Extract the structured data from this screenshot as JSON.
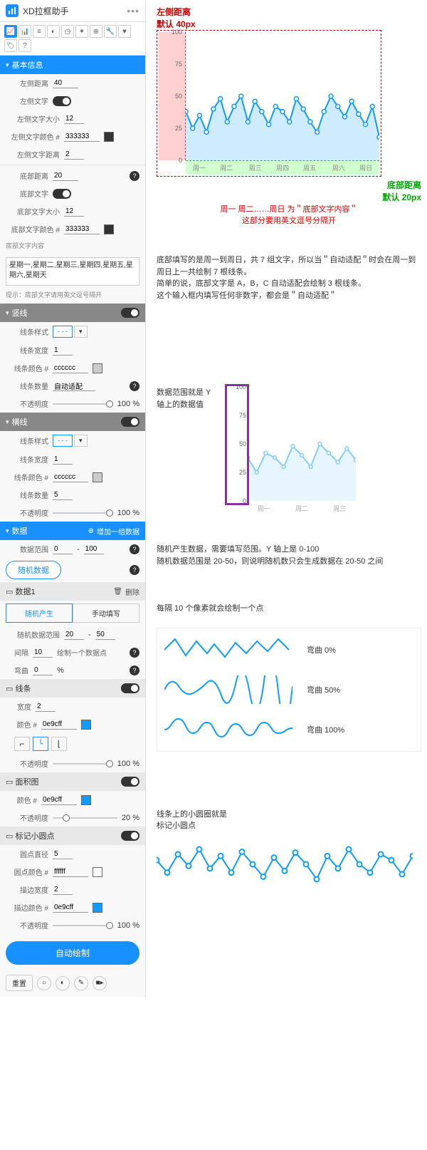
{
  "header": {
    "title": "XD拉框助手",
    "more": "•••"
  },
  "sections": {
    "basic": {
      "title": "基本信息",
      "left_distance_label": "左侧距离",
      "left_distance": "40",
      "left_text_label": "左侧文字",
      "left_text_size_label": "左侧文字大小",
      "left_text_size": "12",
      "left_text_color_label": "左侧文字颜色 #",
      "left_text_color": "333333",
      "left_text_gap_label": "左侧文字距离",
      "left_text_gap": "2",
      "bottom_distance_label": "底部距离",
      "bottom_distance": "20",
      "bottom_text_label": "底部文字",
      "bottom_text_size_label": "底部文字大小",
      "bottom_text_size": "12",
      "bottom_text_color_label": "底部文字颜色 #",
      "bottom_text_color": "333333",
      "bottom_text_content_label": "底部文字内容",
      "bottom_text_content": "星期一,星期二,星期三,星期四,星期五,星期六,星期天",
      "bottom_hint": "提示：底部文字请用英文逗号隔开"
    },
    "vline": {
      "title": "竖线",
      "style_label": "线条样式",
      "width_label": "线条宽度",
      "width": "1",
      "color_label": "线条颜色 #",
      "color": "cccccc",
      "count_label": "线条数量",
      "count": "自动适配",
      "opacity_label": "不透明度",
      "opacity": "100 %"
    },
    "hline": {
      "title": "横线",
      "style_label": "线条样式",
      "width_label": "线条宽度",
      "width": "1",
      "color_label": "线条颜色 #",
      "color": "cccccc",
      "count_label": "线条数量",
      "count": "5",
      "opacity_label": "不透明度",
      "opacity": "100 %"
    },
    "data": {
      "title": "数据",
      "add_label": "增加一组数据",
      "range_label": "数据范围",
      "range_min": "0",
      "range_sep": "-",
      "range_max": "100",
      "random_btn": "随机数据"
    },
    "data1": {
      "title": "数据1",
      "delete_label": "删除",
      "tab_random": "随机产生",
      "tab_manual": "手动填写",
      "random_range_label": "随机数据范围",
      "random_min": "20",
      "random_sep": "-",
      "random_max": "50",
      "interval_label": "间隔",
      "interval": "10",
      "interval_suffix": "绘制一个数据点",
      "bend_label": "弯曲",
      "bend": "0",
      "bend_unit": "%"
    },
    "line": {
      "title": "线条",
      "width_label": "宽度",
      "width": "2",
      "color_label": "颜色 #",
      "color": "0e9cff",
      "opacity_label": "不透明度",
      "opacity": "100 %"
    },
    "area": {
      "title": "面积图",
      "color_label": "颜色 #",
      "color": "0e9cff",
      "opacity_label": "不透明度",
      "opacity": "20 %"
    },
    "marker": {
      "title": "标记小圆点",
      "diameter_label": "圆点直径",
      "diameter": "5",
      "fill_label": "圆点颜色 #",
      "fill": "ffffff",
      "stroke_width_label": "描边宽度",
      "stroke_width": "2",
      "stroke_color_label": "描边颜色 #",
      "stroke_color": "0e9cff",
      "opacity_label": "不透明度",
      "opacity": "100 %"
    },
    "draw_btn": "自动绘制",
    "reset_btn": "重置"
  },
  "annotations": {
    "left_dist_title": "左侧距离\n默认 40px",
    "bottom_dist_title": "底部距离\n默认 20px",
    "chart_caption1": "周一 周二……周日 为＂底部文字内容＂",
    "chart_caption2": "这部分要用英文逗号分隔开",
    "bottom_text_anno": "底部填写的是周一到周日，共 7 组文字，所以当＂自动适配＂时会在周一到周日上一共绘制 7 根线条。\n简单的说，底部文字是 A，B，C 自动适配会绘制 3 根线条。\n这个输入框内填写任何非数字，都会是＂自动适配＂",
    "range_anno": "数据范围就是 Y 轴上的数据值",
    "random_anno": "随机产生数据，需要填写范围。Y 轴上是 0-100\n随机数据范围是 20-50，则说明随机数只会生成数据在 20-50 之间",
    "interval_anno": "每隔 10 个像素就会绘制一个点",
    "curve0": "弯曲 0%",
    "curve50": "弯曲 50%",
    "curve100": "弯曲 100%",
    "marker_anno": "线条上的小圆圈就是\n标记小圆点"
  },
  "chart_data": {
    "type": "line",
    "categories": [
      "周一",
      "周二",
      "周三",
      "周四",
      "周五",
      "周六",
      "周日"
    ],
    "y_ticks": [
      0,
      25,
      50,
      75,
      100
    ],
    "ylim": [
      0,
      100
    ],
    "series": [
      {
        "name": "数据1",
        "values": [
          38,
          25,
          35,
          22,
          40,
          48,
          30,
          42,
          50,
          30,
          46,
          38,
          28,
          42,
          38,
          30,
          48,
          40,
          30,
          22,
          38,
          50,
          42,
          34,
          46,
          36,
          28,
          42,
          18
        ]
      }
    ],
    "second_chart": {
      "type": "line",
      "categories": [
        "周一",
        "周二",
        "周三"
      ],
      "y_ticks": [
        0,
        25,
        50,
        75,
        100
      ],
      "values": [
        38,
        25,
        42,
        38,
        30,
        48,
        40,
        30,
        50,
        42,
        34,
        46,
        36
      ]
    }
  }
}
